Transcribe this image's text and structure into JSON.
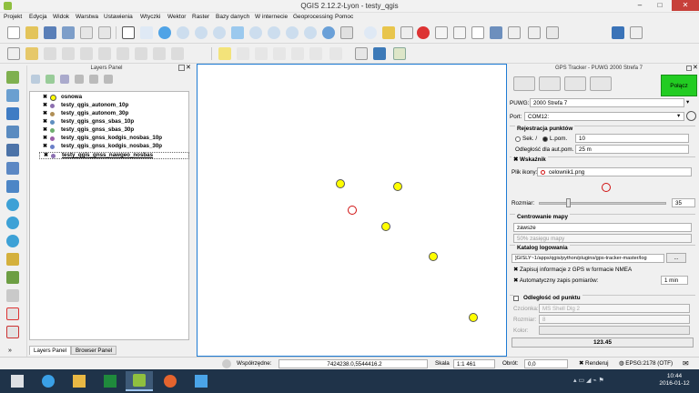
{
  "window": {
    "title": "QGIS 2.12.2-Lyon - testy_qgis",
    "min": "–",
    "max": "□",
    "close": "✕"
  },
  "menu": [
    "Projekt",
    "Edycja",
    "Widok",
    "Warstwa",
    "Ustawienia",
    "Wtyczki",
    "Wektor",
    "Raster",
    "Bazy danych",
    "W internecie",
    "Geoprocessing",
    "Pomoc"
  ],
  "layers_panel": {
    "title": "Layers Panel",
    "layers": [
      {
        "name": "osnowa",
        "checked": "✖",
        "color": "#ffff00"
      },
      {
        "name": "testy_qgis_autonom_10p",
        "checked": "✖",
        "color": "#8c6fb0"
      },
      {
        "name": "testy_qgis_autonom_30p",
        "checked": "✖",
        "color": "#8c6fb0"
      },
      {
        "name": "testy_qgis_gnss_sbas_10p",
        "checked": "✖",
        "color": "#8c6fb0"
      },
      {
        "name": "testy_qgis_gnss_sbas_30p",
        "checked": "✖",
        "color": "#8c6fb0"
      },
      {
        "name": "testy_qgis_gnss_kodgis_nosbas_10p",
        "checked": "✖",
        "color": "#8c6fb0"
      },
      {
        "name": "testy_qgis_gnss_kodgis_nosbas_30p",
        "checked": "✖",
        "color": "#8c6fb0"
      },
      {
        "name": "testy_qgis_gnss_nawgeo_nosbas",
        "checked": "✖",
        "color": "#8c6fb0"
      }
    ],
    "tabs": [
      "Layers Panel",
      "Browser Panel"
    ]
  },
  "gps": {
    "title": "GPS Tracker - PUWG 2000 Strefa 7",
    "connect_label": "Połącz",
    "connect_color": "#22cc22",
    "puwg_label": "PUWG:",
    "puwg_value": "2000 Strefa 7",
    "port_label": "Port:",
    "port_value": "COM12:",
    "reg_title": "Rejestracja punktów",
    "sak_label": "Sek. /",
    "lpom_label": "L.pom.",
    "lpom_value": "10",
    "odl_label": "Odległość dla aut.pom.",
    "odl_value": "25 m",
    "wsk_title": "Wskaźnik",
    "icon_file_label": "Plik ikony:",
    "icon_file_value": "celownik1.png",
    "size_label": "Rozmiar:",
    "size_value": "35",
    "center_title": "Centrowanie mapy",
    "center_value": "zawsze",
    "center_pct": "50% zasięgu mapy",
    "log_title": "Katalog logowania",
    "log_path": "]GISLY~1/apps/qgis/python/plugins/gps-tracker-master/log",
    "browse": "...",
    "nmea_label": "Zapisuj informacje z GPS w formacie NMEA",
    "auto_label": "Automatyczny zapis pomiarów:",
    "auto_value": "1 min",
    "dist_title": "Odległość od punktu",
    "font_label": "Czcionka:",
    "font_value": "MS Shell Dlg 2",
    "fsize_label": "Rozmiar:",
    "fsize_value": "8",
    "color_label": "Kolor:",
    "distance": "123.45"
  },
  "status": {
    "coord_label": "Współrzędne:",
    "coord_value": "7424238.0,5544416.2",
    "scale_label": "Skala",
    "scale_value": "1:1 461",
    "rot_label": "Obrót:",
    "rot_value": "0,0",
    "render_label": "Renderuj",
    "epsg": "EPSG:2178 (OTF)"
  },
  "clock": {
    "time": "10:44",
    "date": "2016-01-12"
  }
}
